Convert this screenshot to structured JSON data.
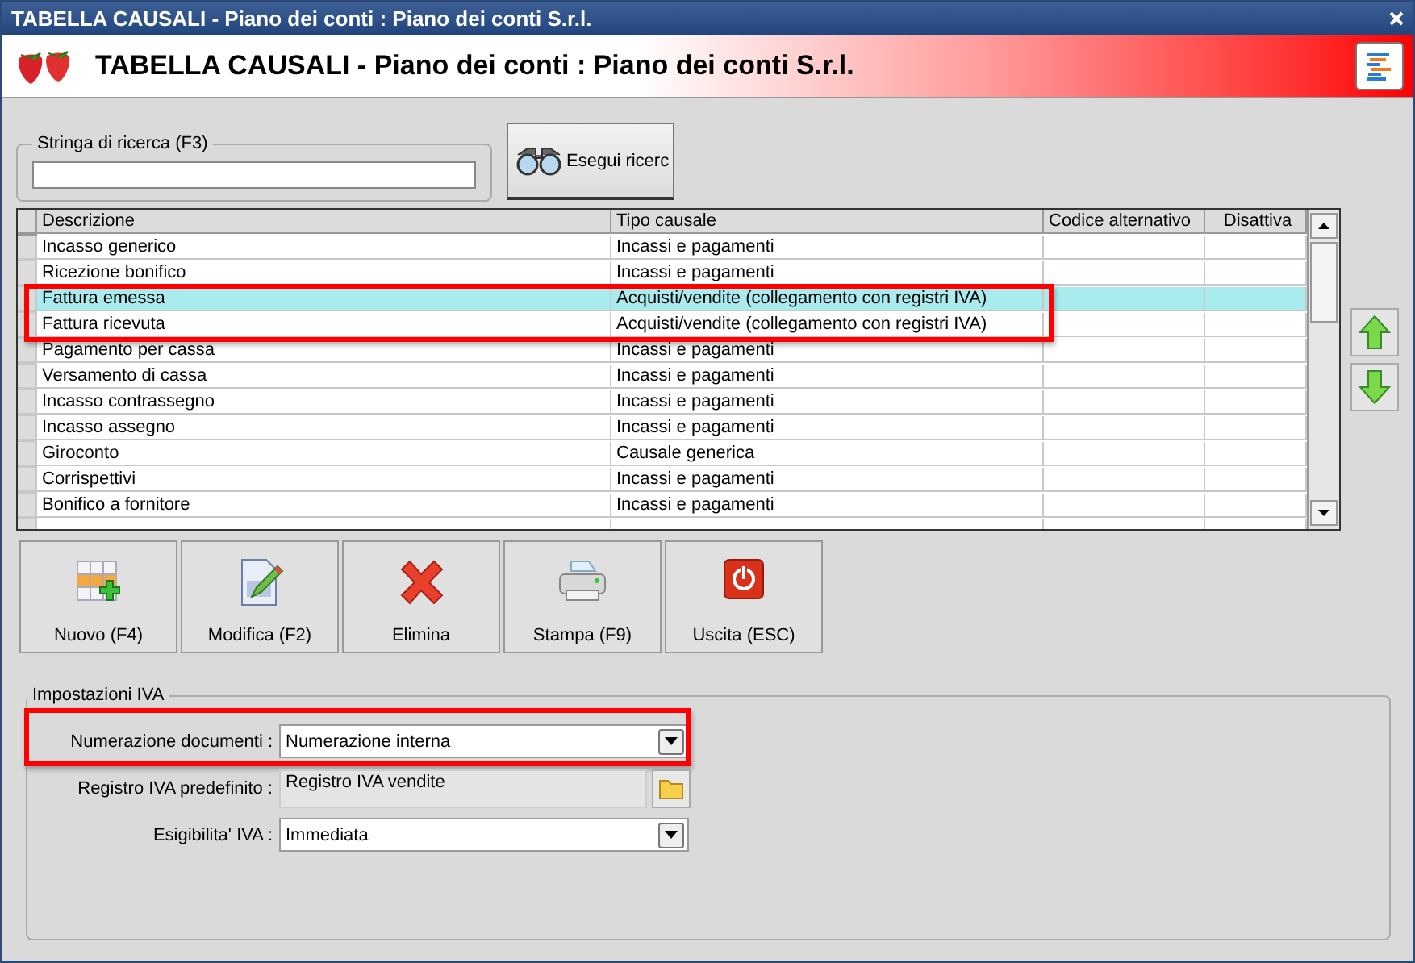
{
  "window": {
    "title": "TABELLA CAUSALI - Piano dei conti : Piano dei conti S.r.l."
  },
  "header": {
    "title": "TABELLA CAUSALI - Piano dei conti : Piano dei conti S.r.l."
  },
  "search": {
    "group_label": "Stringa di ricerca (F3)",
    "button": "Esegui ricerc"
  },
  "table": {
    "columns": [
      "Descrizione",
      "Tipo causale",
      "Codice alternativo",
      "Disattiva"
    ],
    "rows": [
      {
        "descrizione": "Incasso generico",
        "tipo": "Incassi e pagamenti",
        "selected": false
      },
      {
        "descrizione": "Ricezione bonifico",
        "tipo": "Incassi e pagamenti",
        "selected": false
      },
      {
        "descrizione": "Fattura emessa",
        "tipo": "Acquisti/vendite (collegamento con registri IVA)",
        "selected": true
      },
      {
        "descrizione": "Fattura ricevuta",
        "tipo": "Acquisti/vendite (collegamento con registri IVA)",
        "selected": false
      },
      {
        "descrizione": "Pagamento per cassa",
        "tipo": "Incassi e pagamenti",
        "selected": false
      },
      {
        "descrizione": "Versamento di cassa",
        "tipo": "Incassi e pagamenti",
        "selected": false
      },
      {
        "descrizione": "Incasso contrassegno",
        "tipo": "Incassi e pagamenti",
        "selected": false
      },
      {
        "descrizione": "Incasso assegno",
        "tipo": "Incassi e pagamenti",
        "selected": false
      },
      {
        "descrizione": "Giroconto",
        "tipo": "Causale generica",
        "selected": false
      },
      {
        "descrizione": "Corrispettivi",
        "tipo": "Incassi e pagamenti",
        "selected": false
      },
      {
        "descrizione": "Bonifico a fornitore",
        "tipo": "Incassi e pagamenti",
        "selected": false
      }
    ]
  },
  "toolbar": [
    {
      "kind": "new",
      "label": "Nuovo (F4)"
    },
    {
      "kind": "edit",
      "label": "Modifica (F2)"
    },
    {
      "kind": "delete",
      "label": "Elimina"
    },
    {
      "kind": "print",
      "label": "Stampa (F9)"
    },
    {
      "kind": "exit",
      "label": "Uscita (ESC)"
    }
  ],
  "iva": {
    "group_label": "Impostazioni IVA",
    "fields": [
      {
        "kind": "dropdown",
        "label": "Numerazione documenti :",
        "value": "Numerazione interna"
      },
      {
        "kind": "lookup",
        "label": "Registro IVA predefinito :",
        "value": "Registro IVA vendite"
      },
      {
        "kind": "dropdown",
        "label": "Esigibilita' IVA :",
        "value": "Immediata"
      }
    ]
  }
}
